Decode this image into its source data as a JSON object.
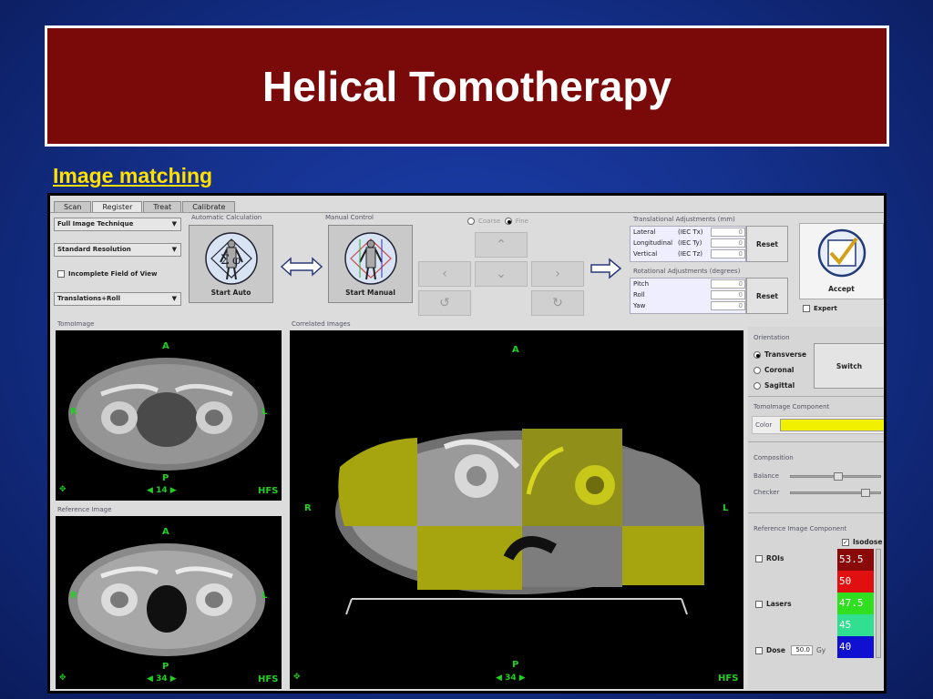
{
  "slide": {
    "title": "Helical Tomotherapy",
    "subtitle": "Image matching",
    "background_color": "#15328f",
    "title_bg_color": "#7a0a0a",
    "subtitle_color": "#ffe000"
  },
  "tabs": [
    "Scan",
    "Register",
    "Treat",
    "Calibrate"
  ],
  "active_tab": "Register",
  "left_controls": {
    "technique": "Full Image Technique",
    "resolution": "Standard Resolution",
    "incomplete_fov": "Incomplete Field of View",
    "transform": "Translations+Roll"
  },
  "auto_calc": {
    "label": "Automatic Calculation",
    "button": "Start Auto"
  },
  "manual_control": {
    "label": "Manual Control",
    "button": "Start Manual",
    "coarse": "Coarse",
    "fine": "Fine",
    "fine_selected": true
  },
  "translational": {
    "label": "Translational Adjustments (mm)",
    "rows": [
      {
        "name": "Lateral",
        "unit": "(IEC Tx)",
        "value": "0"
      },
      {
        "name": "Longitudinal",
        "unit": "(IEC Ty)",
        "value": "0"
      },
      {
        "name": "Vertical",
        "unit": "(IEC Tz)",
        "value": "0"
      }
    ],
    "reset": "Reset"
  },
  "rotational": {
    "label": "Rotational Adjustments (degrees)",
    "rows": [
      {
        "name": "Pitch",
        "value": "0"
      },
      {
        "name": "Roll",
        "value": "0"
      },
      {
        "name": "Yaw",
        "value": "0"
      }
    ],
    "reset": "Reset"
  },
  "accept": {
    "button": "Accept",
    "expert": "Expert"
  },
  "tomo_panel": {
    "label": "TomoImage",
    "top": "A",
    "left": "R",
    "right": "L",
    "bottom": "P",
    "slice": "14",
    "position": "HFS"
  },
  "ref_panel": {
    "label": "Reference Image",
    "top": "A",
    "left": "R",
    "right": "L",
    "bottom": "P",
    "slice": "34",
    "position": "HFS"
  },
  "correlated_panel": {
    "label": "Correlated Images",
    "top": "A",
    "left": "R",
    "right": "L",
    "bottom": "P",
    "slice": "34",
    "position": "HFS"
  },
  "orientation": {
    "label": "Orientation",
    "options": [
      "Transverse",
      "Coronal",
      "Sagittal"
    ],
    "selected": "Transverse",
    "switch": "Switch"
  },
  "tomo_component": {
    "label": "TomoImage Component",
    "color_label": "Color",
    "color": "#f0f000"
  },
  "composition": {
    "label": "Composition",
    "balance": "Balance",
    "checker": "Checker",
    "balance_value": 0.52,
    "checker_value": 0.85
  },
  "ref_component": {
    "label": "Reference Image Component",
    "isodose": "Isodose",
    "rois": "ROIs",
    "lasers": "Lasers",
    "dose": "Dose",
    "dose_value": "50.0",
    "dose_unit": "Gy",
    "isodose_levels": [
      {
        "value": "53.5",
        "color": "#8a0a0a"
      },
      {
        "value": "50",
        "color": "#e01010"
      },
      {
        "value": "47.5",
        "color": "#30e020"
      },
      {
        "value": "45",
        "color": "#30e090"
      },
      {
        "value": "40",
        "color": "#1010d0"
      }
    ]
  }
}
